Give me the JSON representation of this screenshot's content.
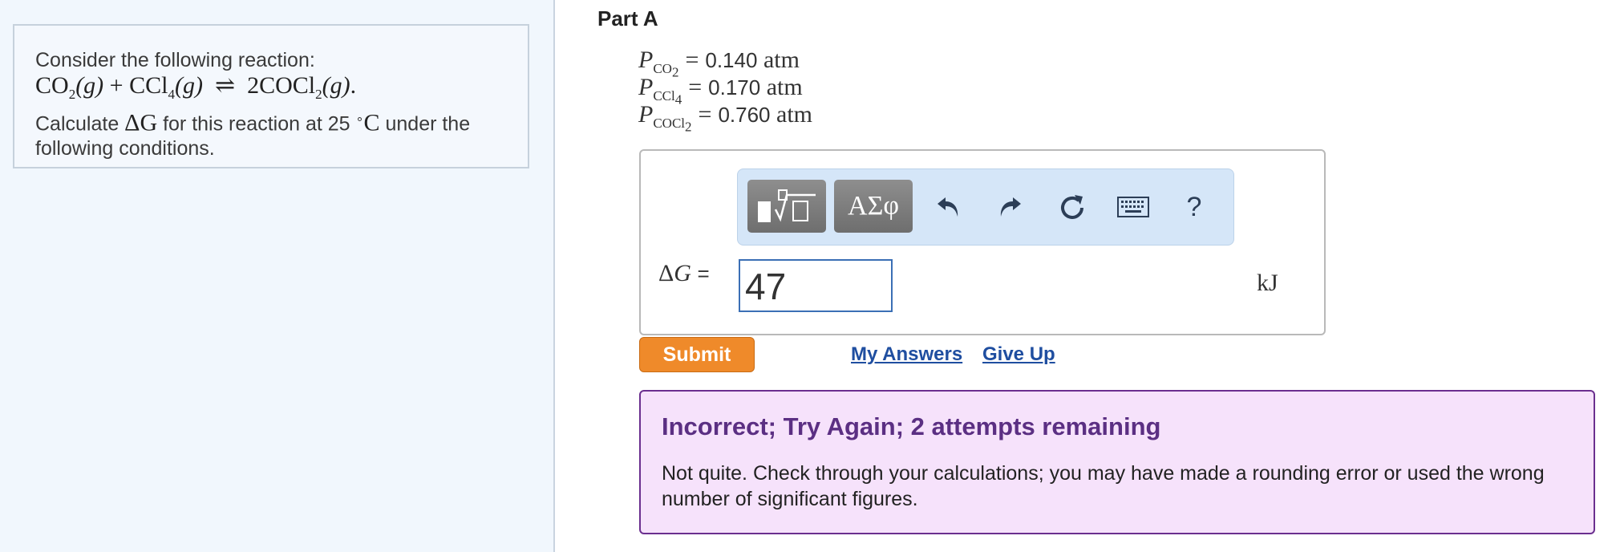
{
  "question": {
    "intro": "Consider the following reaction:",
    "reaction": {
      "reactant1": "CO",
      "reactant1_sub": "2",
      "phase": "(g)",
      "plus": "+",
      "reactant2": "CCl",
      "reactant2_sub": "4",
      "arrow": "⇌",
      "product": "2COCl",
      "product_sub": "2",
      "end": "."
    },
    "prompt_before": "Calculate ",
    "delta_g": "ΔG",
    "prompt_middle": " for this reaction at 25 ",
    "degree": "∘",
    "celsius": "C",
    "prompt_after": " under the",
    "prompt_line2": "following conditions."
  },
  "part": {
    "title": "Part A"
  },
  "conditions": [
    {
      "symbol": "P",
      "species": "CO",
      "sub": "2",
      "equals": "=",
      "value": "0.140",
      "unit": "atm"
    },
    {
      "symbol": "P",
      "species": "CCl",
      "sub": "4",
      "equals": "=",
      "value": "0.170",
      "unit": "atm"
    },
    {
      "symbol": "P",
      "species": "COCl",
      "sub": "2",
      "equals": "=",
      "value": "0.760",
      "unit": "atm"
    }
  ],
  "toolbar": {
    "symbols_label": "ΑΣφ",
    "help_label": "?",
    "icons": [
      "templates-icon",
      "undo-icon",
      "redo-icon",
      "reset-icon",
      "keyboard-icon",
      "help-icon"
    ]
  },
  "answer": {
    "delta": "Δ",
    "variable": "G",
    "equals": "=",
    "value": "47",
    "unit": "kJ"
  },
  "actions": {
    "submit": "Submit",
    "my_answers": "My Answers",
    "give_up": "Give Up"
  },
  "feedback": {
    "title": "Incorrect; Try Again; 2 attempts remaining",
    "message": "Not quite. Check through your calculations; you may have made a rounding error or used the wrong number of significant figures."
  },
  "colors": {
    "submit": "#ef8a2a",
    "link": "#1f4ea0",
    "feedback_border": "#6b2f8f",
    "feedback_bg": "#f6e2fb",
    "input_border": "#3b6fb5"
  }
}
